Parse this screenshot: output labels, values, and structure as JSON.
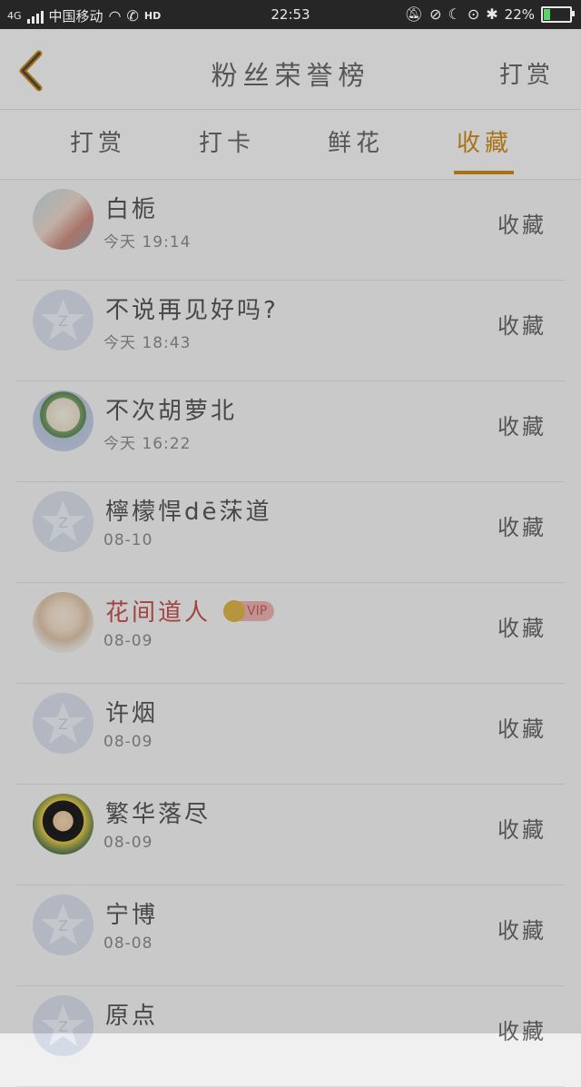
{
  "status_bar": {
    "network": "4G",
    "carrier": "中国移动",
    "hd_label": "HD",
    "time": "22:53",
    "battery": "22%"
  },
  "header": {
    "title": "粉丝荣誉榜",
    "action_label": "打赏"
  },
  "tabs": [
    {
      "label": "打赏"
    },
    {
      "label": "打卡"
    },
    {
      "label": "鲜花"
    },
    {
      "label": "收藏"
    }
  ],
  "list": [
    {
      "name": "白栀",
      "time": "今天 19:14",
      "action": "收藏",
      "avatar": "photo-avatar"
    },
    {
      "name": "不说再见好吗?",
      "time": "今天 18:43",
      "action": "收藏",
      "avatar": "default-avatar"
    },
    {
      "name": "不次胡萝北",
      "time": "今天 16:22",
      "action": "收藏",
      "avatar": "photo-avatar"
    },
    {
      "name": "檸檬悍dē莯道",
      "time": "08-10",
      "action": "收藏",
      "avatar": "default-avatar"
    },
    {
      "name": "花间道人",
      "badge": "VIP",
      "time": "08-09",
      "action": "收藏",
      "avatar": "photo-avatar"
    },
    {
      "name": "许烟",
      "time": "08-09",
      "action": "收藏",
      "avatar": "default-avatar"
    },
    {
      "name": "繁华落尽",
      "time": "08-09",
      "action": "收藏",
      "avatar": "photo-avatar"
    },
    {
      "name": "宁博",
      "time": "08-08",
      "action": "收藏",
      "avatar": "default-avatar"
    },
    {
      "name": "原点",
      "time": "",
      "action": "收藏",
      "avatar": "default-avatar"
    }
  ],
  "colors": {
    "accent": "#c98a1a",
    "vip_name": "#c0504d"
  }
}
